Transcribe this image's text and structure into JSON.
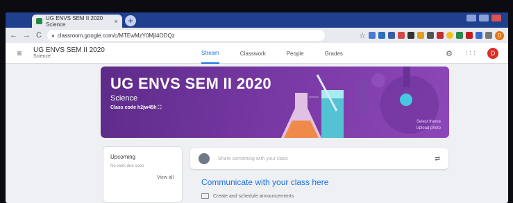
{
  "browser": {
    "tab_title": "UG ENVS SEM II 2020 Science",
    "tab_close": "×",
    "new_tab": "+",
    "back": "←",
    "forward": "→",
    "reload": "C",
    "url": "classroom.google.com/c/MTEwMzY0MjI4ODQz",
    "star": "☆",
    "profile_initial": "D"
  },
  "app": {
    "menu_icon": "≡",
    "class_name": "UG ENVS SEM II 2020",
    "class_section": "Science",
    "tabs": [
      "Stream",
      "Classwork",
      "People",
      "Grades"
    ],
    "active_tab": "Stream",
    "settings_icon": "⚙",
    "apps_icon": "⋮⋮⋮",
    "user_initial": "D"
  },
  "banner": {
    "title": "UG ENVS SEM II 2020",
    "subtitle": "Science",
    "class_code_label": "Class code",
    "class_code": "h2jw45h",
    "fullscreen_icon": "⛶",
    "select_theme": "Select theme",
    "upload_photo": "Upload photo"
  },
  "upcoming": {
    "heading": "Upcoming",
    "sub": "No work due soon",
    "view_all": "View all"
  },
  "share": {
    "placeholder": "Share something with your class",
    "repost_icon": "⇄"
  },
  "communicate": {
    "heading": "Communicate with your class here",
    "item": "Create and schedule announcements"
  },
  "colors": {
    "banner": "#7a3aa6",
    "accent": "#1a73e8",
    "browser_frame": "#1f3f8f"
  }
}
